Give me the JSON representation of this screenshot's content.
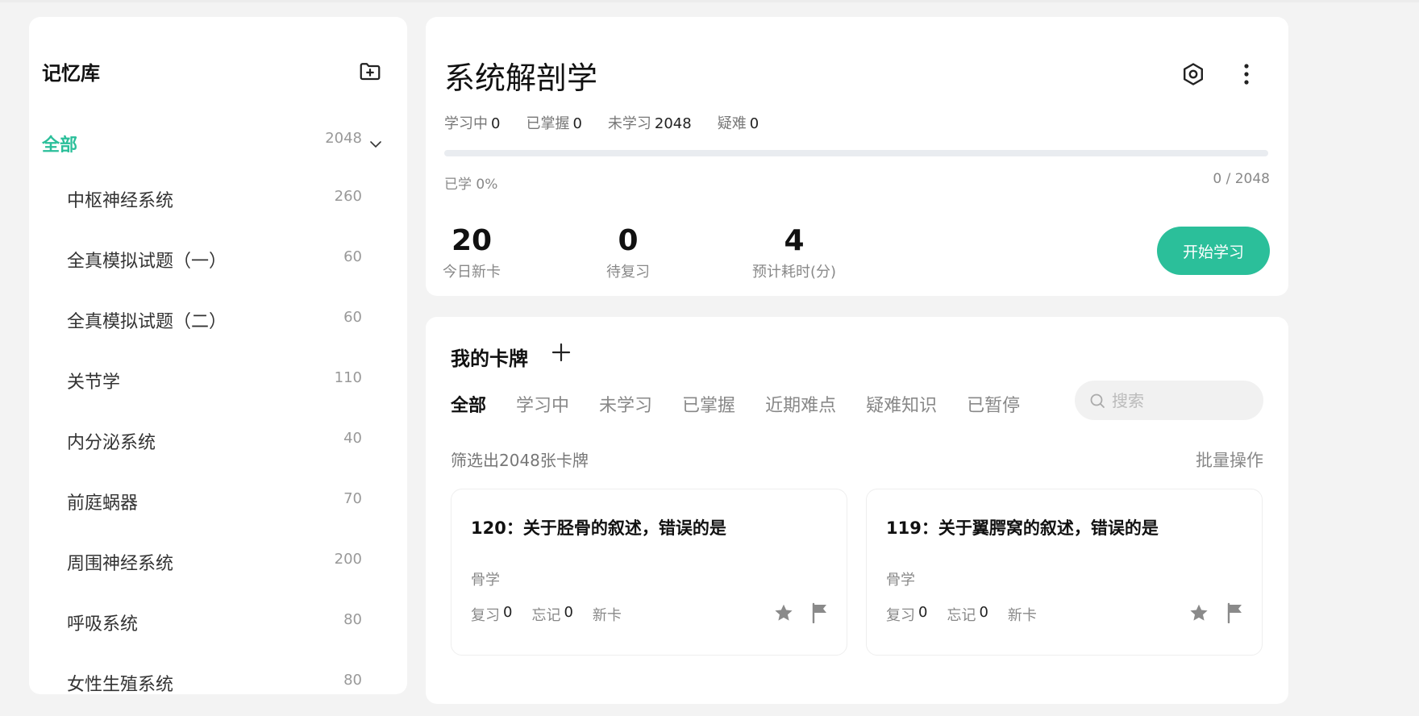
{
  "colors": {
    "accent": "#2bbf9a",
    "background": "#f3f3f3",
    "panel": "#ffffff"
  },
  "sidebar": {
    "title": "记忆库",
    "add_icon": "folder-plus-icon",
    "all": {
      "label": "全部",
      "count": "2048"
    },
    "items": [
      {
        "label": "中枢神经系统",
        "count": "260"
      },
      {
        "label": "全真模拟试题（一）",
        "count": "60"
      },
      {
        "label": "全真模拟试题（二）",
        "count": "60"
      },
      {
        "label": "关节学",
        "count": "110"
      },
      {
        "label": "内分泌系统",
        "count": "40"
      },
      {
        "label": "前庭蜗器",
        "count": "70"
      },
      {
        "label": "周围神经系统",
        "count": "200"
      },
      {
        "label": "呼吸系统",
        "count": "80"
      },
      {
        "label": "女性生殖系统",
        "count": "80"
      }
    ]
  },
  "summary": {
    "title": "系统解剖学",
    "stats": [
      {
        "label": "学习中",
        "value": "0"
      },
      {
        "label": "已掌握",
        "value": "0"
      },
      {
        "label": "未学习",
        "value": "2048"
      },
      {
        "label": "疑难",
        "value": "0"
      }
    ],
    "progress_fraction": 0,
    "learned_text": "已学 0%",
    "ratio_text": "0 / 2048",
    "metrics": [
      {
        "num": "20",
        "label": "今日新卡"
      },
      {
        "num": "0",
        "label": "待复习"
      },
      {
        "num": "4",
        "label": "预计耗时(分)"
      }
    ],
    "start_button": "开始学习"
  },
  "cards_panel": {
    "title": "我的卡牌",
    "tabs": [
      "全部",
      "学习中",
      "未学习",
      "已掌握",
      "近期难点",
      "疑难知识",
      "已暂停"
    ],
    "active_tab": 0,
    "search_placeholder": "搜索",
    "filter_info": "筛选出2048张卡牌",
    "batch_label": "批量操作",
    "cards": [
      {
        "question": "120：关于胫骨的叙述，错误的是",
        "tag": "骨学",
        "review_label": "复习",
        "review_value": "0",
        "forget_label": "忘记",
        "forget_value": "0",
        "status": "新卡"
      },
      {
        "question": "119：关于翼腭窝的叙述，错误的是",
        "tag": "骨学",
        "review_label": "复习",
        "review_value": "0",
        "forget_label": "忘记",
        "forget_value": "0",
        "status": "新卡"
      }
    ]
  }
}
